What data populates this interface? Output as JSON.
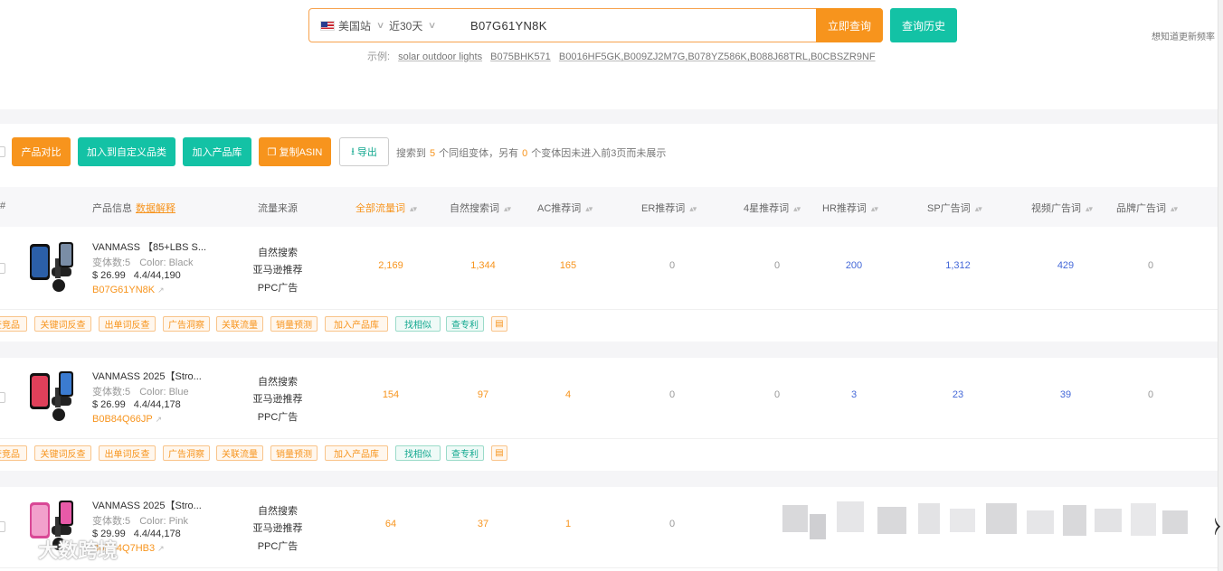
{
  "search": {
    "site": "美国站",
    "period": "近30天",
    "query": "B07G61YN8K",
    "submit_label": "立即查询",
    "history_label": "查询历史"
  },
  "examples": {
    "prefix": "示例:",
    "items": [
      "solar outdoor lights",
      "B075BHK571",
      "B0016HF5GK,B009ZJ2M7G,B078YZ586K,B088J68TRL,B0CBSZR9NF"
    ]
  },
  "top_tip": "想知道更新频率",
  "toolbar": {
    "compare": "产品对比",
    "add_category": "加入到自定义品类",
    "add_library": "加入产品库",
    "copy_asin": "复制ASIN",
    "export": "导出",
    "result_pre": "搜索到",
    "result_count": "5",
    "result_mid": "个同组变体，另有",
    "hidden_count": "0",
    "result_post": "个变体因未进入前3页而未展示"
  },
  "table": {
    "headers": {
      "index": "#",
      "product": "产品信息",
      "product_link": "数据解释",
      "source": "流量来源",
      "all_kw": "全部流量词",
      "organic": "自然搜索词",
      "ac": "AC推荐词",
      "er": "ER推荐词",
      "star4": "4星推荐词",
      "hr": "HR推荐词",
      "sp": "SP广告词",
      "video": "视频广告词",
      "brand": "品牌广告词"
    },
    "sources": [
      "自然搜索",
      "亚马逊推荐",
      "PPC广告"
    ],
    "rows": [
      {
        "name": "VANMASS 【85+LBS S...",
        "variants": "变体数:5",
        "color": "Color: Black",
        "price": "$ 26.99",
        "rating": "4.4/44,190",
        "asin": "B07G61YN8K",
        "all_kw": "2,169",
        "organic": "1,344",
        "ac": "165",
        "er": "0",
        "star4": "0",
        "hr": "200",
        "sp": "1,312",
        "video": "429",
        "brand": "0",
        "device_color": "#2b5fa8"
      },
      {
        "name": "VANMASS 2025【Stro...",
        "variants": "变体数:5",
        "color": "Color: Blue",
        "price": "$ 26.99",
        "rating": "4.4/44,178",
        "asin": "B0B84Q66JP",
        "all_kw": "154",
        "organic": "97",
        "ac": "4",
        "er": "0",
        "star4": "0",
        "hr": "3",
        "sp": "23",
        "video": "39",
        "brand": "0",
        "device_color": "#3b7bd0"
      },
      {
        "name": "VANMASS 2025【Stro...",
        "variants": "变体数:5",
        "color": "Color: Pink",
        "price": "$ 29.99",
        "rating": "4.4/44,178",
        "asin": "B0B84Q7HB3",
        "all_kw": "64",
        "organic": "37",
        "ac": "1",
        "er": "0",
        "device_color": "#e85aa8"
      }
    ],
    "actions": [
      "查竞品",
      "关键词反查",
      "出单词反查",
      "广告洞察",
      "关联流量",
      "销量预测",
      "加入产品库",
      "找相似",
      "查专利"
    ]
  },
  "watermark": "大数跨境",
  "colors": {
    "accent": "#f7941d",
    "teal": "#13c2a5",
    "blue": "#4468d8"
  }
}
